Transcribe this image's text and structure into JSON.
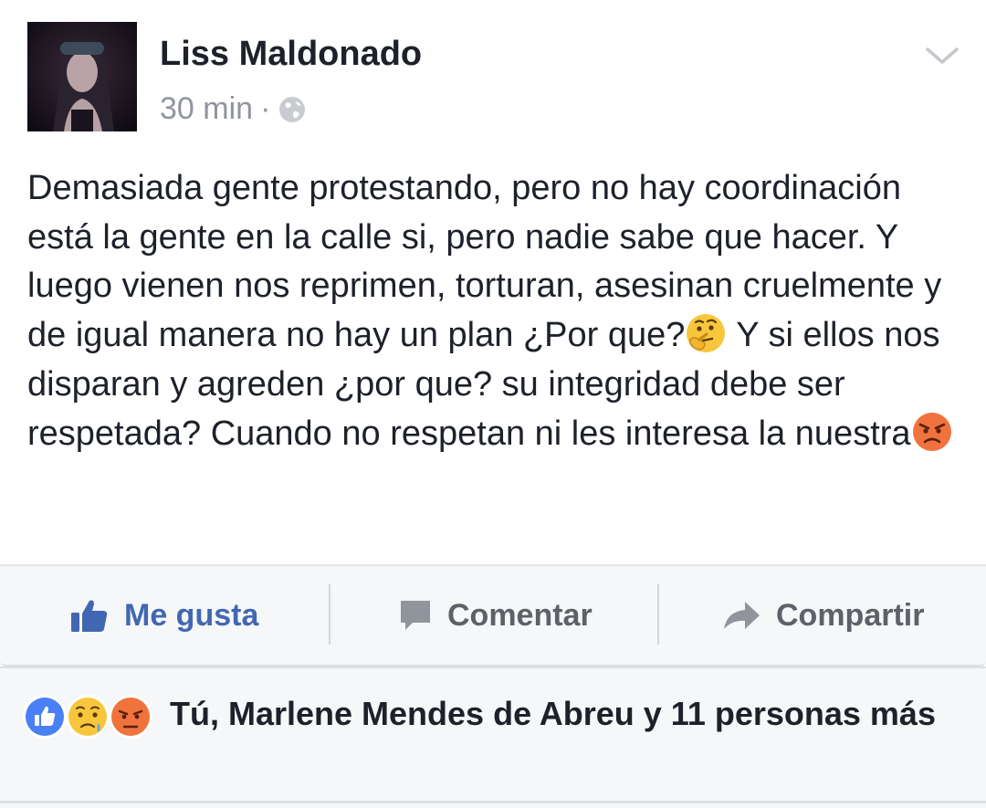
{
  "post": {
    "author": "Liss Maldonado",
    "time": "30 min",
    "separator": "·",
    "privacy_icon": "globe-icon",
    "text_part1": "Demasiada gente protestando, pero no hay coordinación está la gente en la calle si, pero nadie sabe que hacer. Y luego vienen nos reprimen, torturan, asesinan cruelmente y de igual manera no hay un plan ¿Por que?",
    "emoji1": "thinking-face-emoji",
    "text_part2": " Y si ellos nos disparan y agreden ¿por que? su integridad debe ser respetada? Cuando no respetan ni les interesa la nuestra",
    "emoji2": "angry-face-emoji"
  },
  "actions": {
    "like_label": "Me gusta",
    "comment_label": "Comentar",
    "share_label": "Compartir"
  },
  "reactions": {
    "icons": [
      "like-reaction-icon",
      "sad-reaction-icon",
      "angry-reaction-icon"
    ],
    "summary": "Tú, Marlene Mendes de Abreu y 11 personas más"
  },
  "colors": {
    "accent": "#4267b2",
    "text": "#1d2129",
    "muted": "#90949c",
    "bar_bg": "#f6f7f9"
  }
}
